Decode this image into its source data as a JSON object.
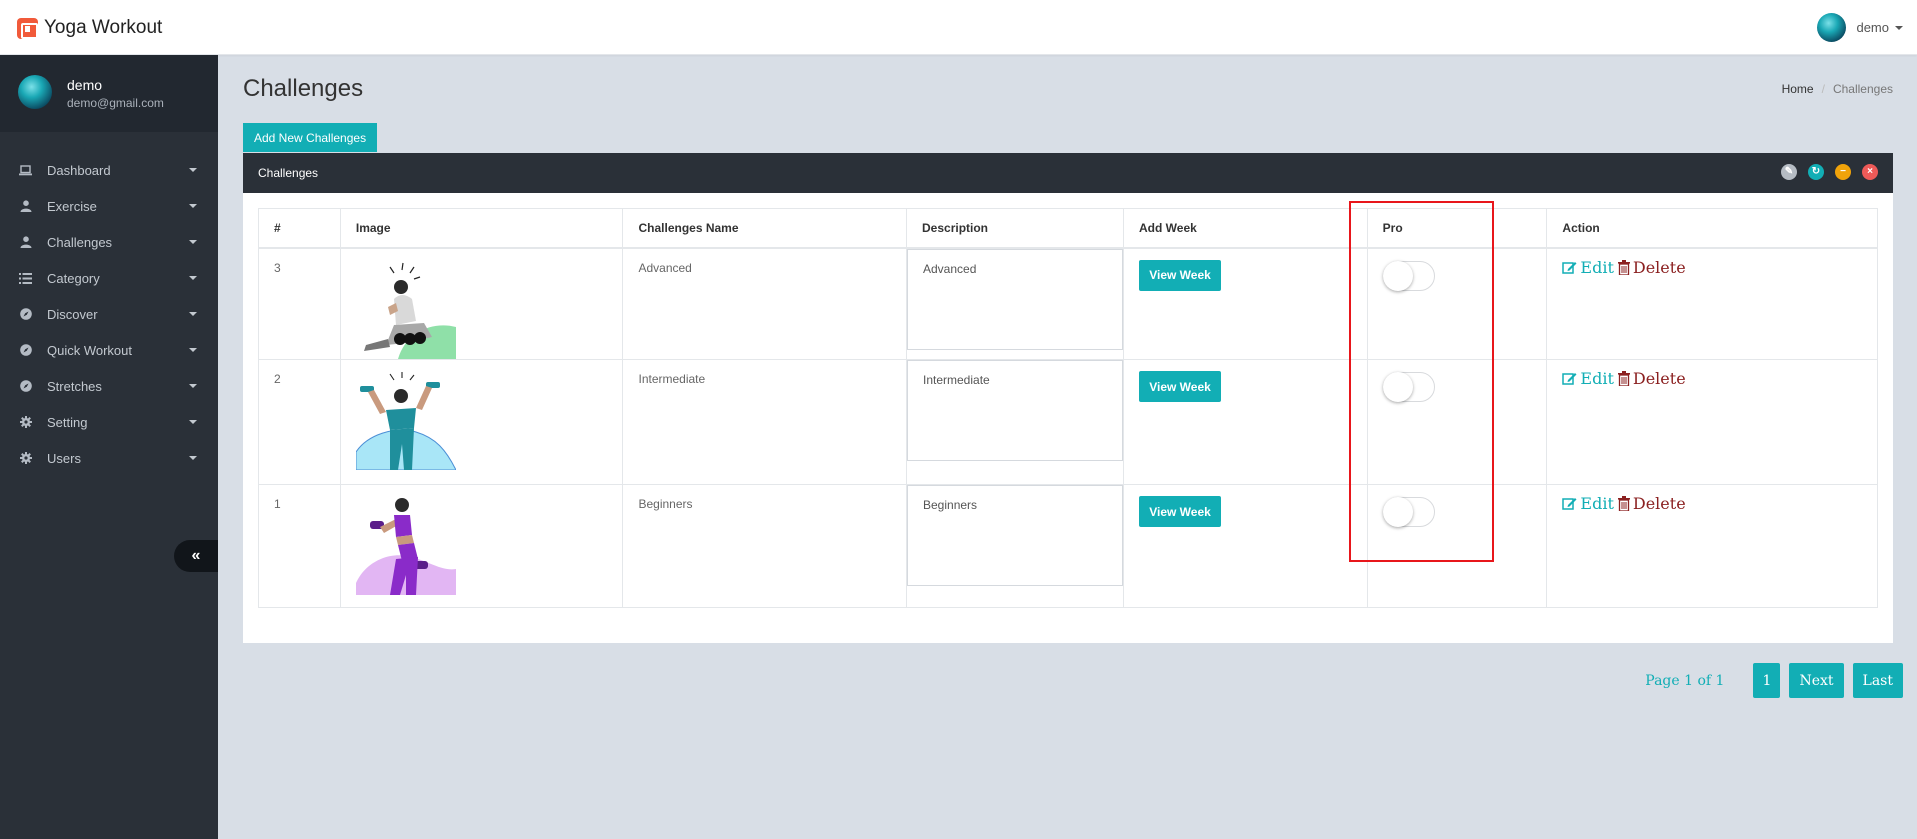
{
  "app": {
    "title": "Yoga Workout"
  },
  "topbar": {
    "user_name": "demo"
  },
  "sidebar": {
    "profile": {
      "name": "demo",
      "email": "demo@gmail.com"
    },
    "items": [
      {
        "label": "Dashboard",
        "icon": "laptop-icon"
      },
      {
        "label": "Exercise",
        "icon": "user-icon"
      },
      {
        "label": "Challenges",
        "icon": "user-icon"
      },
      {
        "label": "Category",
        "icon": "list-icon"
      },
      {
        "label": "Discover",
        "icon": "compass-icon"
      },
      {
        "label": "Quick Workout",
        "icon": "compass-icon"
      },
      {
        "label": "Stretches",
        "icon": "compass-icon"
      },
      {
        "label": "Setting",
        "icon": "gear-icon"
      },
      {
        "label": "Users",
        "icon": "gear-icon"
      }
    ],
    "collapse_icon": "double-chevron-left-icon"
  },
  "page": {
    "title": "Challenges",
    "breadcrumb": {
      "home": "Home",
      "current": "Challenges"
    },
    "add_button": "Add New Challenges"
  },
  "panel": {
    "title": "Challenges",
    "tools": [
      "edit-icon",
      "refresh-icon",
      "minimize-icon",
      "close-icon"
    ],
    "columns": [
      "#",
      "Image",
      "Challenges Name",
      "Description",
      "Add Week",
      "Pro",
      "Action"
    ],
    "rows": [
      {
        "id": "3",
        "name": "Advanced",
        "description": "Advanced",
        "week_button": "View Week",
        "pro": false,
        "edit": "Edit",
        "delete": "Delete"
      },
      {
        "id": "2",
        "name": "Intermediate",
        "description": "Intermediate",
        "week_button": "View Week",
        "pro": false,
        "edit": "Edit",
        "delete": "Delete"
      },
      {
        "id": "1",
        "name": "Beginners",
        "description": "Beginners",
        "week_button": "View Week",
        "pro": false,
        "edit": "Edit",
        "delete": "Delete"
      }
    ]
  },
  "pagination": {
    "info": "Page 1 of 1",
    "page": "1",
    "next": "Next",
    "last": "Last"
  },
  "colors": {
    "accent": "#12aeb5",
    "sidebar": "#2a3038",
    "danger": "#8b2020",
    "highlight": "#e8161b"
  }
}
